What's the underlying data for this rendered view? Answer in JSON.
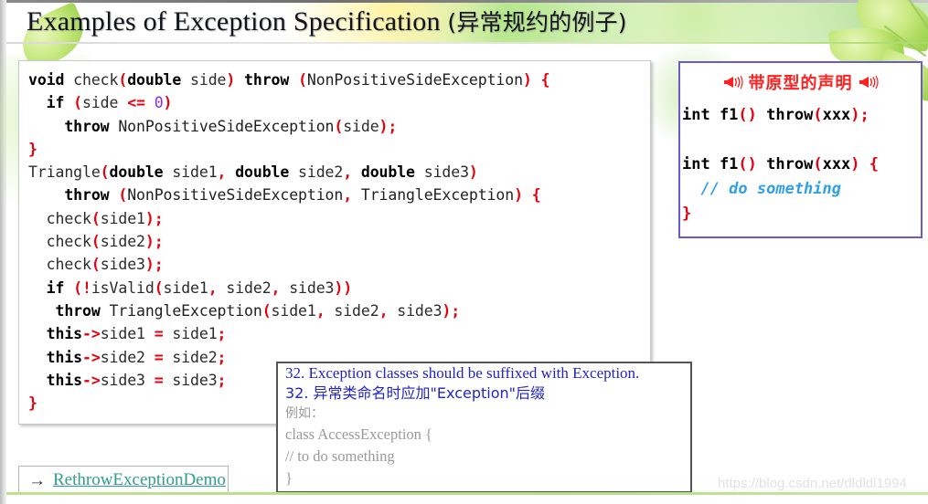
{
  "slide": {
    "title_en": "Examples of Exception Specification ",
    "title_cn": "(异常规约的例子)",
    "watermark": "https://blog.csdn.net/dldldl1994"
  },
  "code_box": {
    "lines": [
      [
        {
          "t": "void ",
          "c": "k"
        },
        {
          "t": "check",
          "c": "t"
        },
        {
          "t": "(",
          "c": "p"
        },
        {
          "t": "double ",
          "c": "k"
        },
        {
          "t": "side",
          "c": "t"
        },
        {
          "t": ") ",
          "c": "p"
        },
        {
          "t": "throw ",
          "c": "k"
        },
        {
          "t": "(",
          "c": "p"
        },
        {
          "t": "NonPositiveSideException",
          "c": "ty"
        },
        {
          "t": ") {",
          "c": "p"
        }
      ],
      [
        {
          "t": "  if ",
          "c": "k"
        },
        {
          "t": "(",
          "c": "p"
        },
        {
          "t": "side ",
          "c": "t"
        },
        {
          "t": "<= ",
          "c": "op"
        },
        {
          "t": "0",
          "c": "n"
        },
        {
          "t": ")",
          "c": "p"
        }
      ],
      [
        {
          "t": "    throw ",
          "c": "k"
        },
        {
          "t": "NonPositiveSideException",
          "c": "ty"
        },
        {
          "t": "(",
          "c": "p"
        },
        {
          "t": "side",
          "c": "t"
        },
        {
          "t": ");",
          "c": "p"
        }
      ],
      [
        {
          "t": "}",
          "c": "p"
        }
      ],
      [
        {
          "t": "Triangle",
          "c": "t"
        },
        {
          "t": "(",
          "c": "p"
        },
        {
          "t": "double ",
          "c": "k"
        },
        {
          "t": "side1",
          "c": "t"
        },
        {
          "t": ", ",
          "c": "p"
        },
        {
          "t": "double ",
          "c": "k"
        },
        {
          "t": "side2",
          "c": "t"
        },
        {
          "t": ", ",
          "c": "p"
        },
        {
          "t": "double ",
          "c": "k"
        },
        {
          "t": "side3",
          "c": "t"
        },
        {
          "t": ")",
          "c": "p"
        }
      ],
      [
        {
          "t": "    throw ",
          "c": "k"
        },
        {
          "t": "(",
          "c": "p"
        },
        {
          "t": "NonPositiveSideException",
          "c": "ty"
        },
        {
          "t": ", ",
          "c": "p"
        },
        {
          "t": "TriangleException",
          "c": "ty"
        },
        {
          "t": ") {",
          "c": "p"
        }
      ],
      [
        {
          "t": "  check",
          "c": "t"
        },
        {
          "t": "(",
          "c": "p"
        },
        {
          "t": "side1",
          "c": "t"
        },
        {
          "t": ");",
          "c": "p"
        }
      ],
      [
        {
          "t": "  check",
          "c": "t"
        },
        {
          "t": "(",
          "c": "p"
        },
        {
          "t": "side2",
          "c": "t"
        },
        {
          "t": ");",
          "c": "p"
        }
      ],
      [
        {
          "t": "  check",
          "c": "t"
        },
        {
          "t": "(",
          "c": "p"
        },
        {
          "t": "side3",
          "c": "t"
        },
        {
          "t": ");",
          "c": "p"
        }
      ],
      [
        {
          "t": "  if ",
          "c": "k"
        },
        {
          "t": "(!",
          "c": "p"
        },
        {
          "t": "isValid",
          "c": "t"
        },
        {
          "t": "(",
          "c": "p"
        },
        {
          "t": "side1",
          "c": "t"
        },
        {
          "t": ", ",
          "c": "p"
        },
        {
          "t": "side2",
          "c": "t"
        },
        {
          "t": ", ",
          "c": "p"
        },
        {
          "t": "side3",
          "c": "t"
        },
        {
          "t": "))",
          "c": "p"
        }
      ],
      [
        {
          "t": "   throw ",
          "c": "k"
        },
        {
          "t": "TriangleException",
          "c": "ty"
        },
        {
          "t": "(",
          "c": "p"
        },
        {
          "t": "side1",
          "c": "t"
        },
        {
          "t": ", ",
          "c": "p"
        },
        {
          "t": "side2",
          "c": "t"
        },
        {
          "t": ", ",
          "c": "p"
        },
        {
          "t": "side3",
          "c": "t"
        },
        {
          "t": ");",
          "c": "p"
        }
      ],
      [
        {
          "t": "  this",
          "c": "k"
        },
        {
          "t": "->",
          "c": "p"
        },
        {
          "t": "side1 ",
          "c": "t"
        },
        {
          "t": "= ",
          "c": "op"
        },
        {
          "t": "side1",
          "c": "t"
        },
        {
          "t": ";",
          "c": "p"
        }
      ],
      [
        {
          "t": "  this",
          "c": "k"
        },
        {
          "t": "->",
          "c": "p"
        },
        {
          "t": "side2 ",
          "c": "t"
        },
        {
          "t": "= ",
          "c": "op"
        },
        {
          "t": "side2",
          "c": "t"
        },
        {
          "t": ";",
          "c": "p"
        }
      ],
      [
        {
          "t": "  this",
          "c": "k"
        },
        {
          "t": "->",
          "c": "p"
        },
        {
          "t": "side3 ",
          "c": "t"
        },
        {
          "t": "= ",
          "c": "op"
        },
        {
          "t": "side3",
          "c": "t"
        },
        {
          "t": ";",
          "c": "p"
        }
      ],
      [
        {
          "t": "}",
          "c": "p"
        }
      ]
    ]
  },
  "proto_box": {
    "title": "带原型的声明",
    "lines": [
      [
        {
          "t": "int f1",
          "c": "k"
        },
        {
          "t": "()",
          "c": "p"
        },
        {
          "t": " throw",
          "c": "k"
        },
        {
          "t": "(",
          "c": "p"
        },
        {
          "t": "xxx",
          "c": "k"
        },
        {
          "t": ");",
          "c": "p"
        }
      ],
      [
        {
          "t": "",
          "c": "t"
        }
      ],
      [
        {
          "t": "int f1",
          "c": "k"
        },
        {
          "t": "()",
          "c": "p"
        },
        {
          "t": " throw",
          "c": "k"
        },
        {
          "t": "(",
          "c": "p"
        },
        {
          "t": "xxx",
          "c": "k"
        },
        {
          "t": ") {",
          "c": "p"
        }
      ],
      [
        {
          "t": "  // do something",
          "c": "cmt"
        }
      ],
      [
        {
          "t": "}",
          "c": "p"
        }
      ]
    ]
  },
  "rule_box": {
    "line_en": "32. Exception classes should be suffixed with Exception.",
    "line_cn": "32. 异常类命名时应加\"Exception\"后缀",
    "example_label": "例如：",
    "code_line_1": "class AccessException {",
    "code_line_2": " // to do something",
    "code_line_3": "}"
  },
  "demo_link": {
    "arrow": "→",
    "label": "RethrowExceptionDemo"
  },
  "colors": {
    "accent_green": "#a9d96a",
    "proto_border": "#6a5acd",
    "rule_blue": "#2323c8",
    "link_teal": "#2f9d8f",
    "code_red": "#e8000d"
  }
}
